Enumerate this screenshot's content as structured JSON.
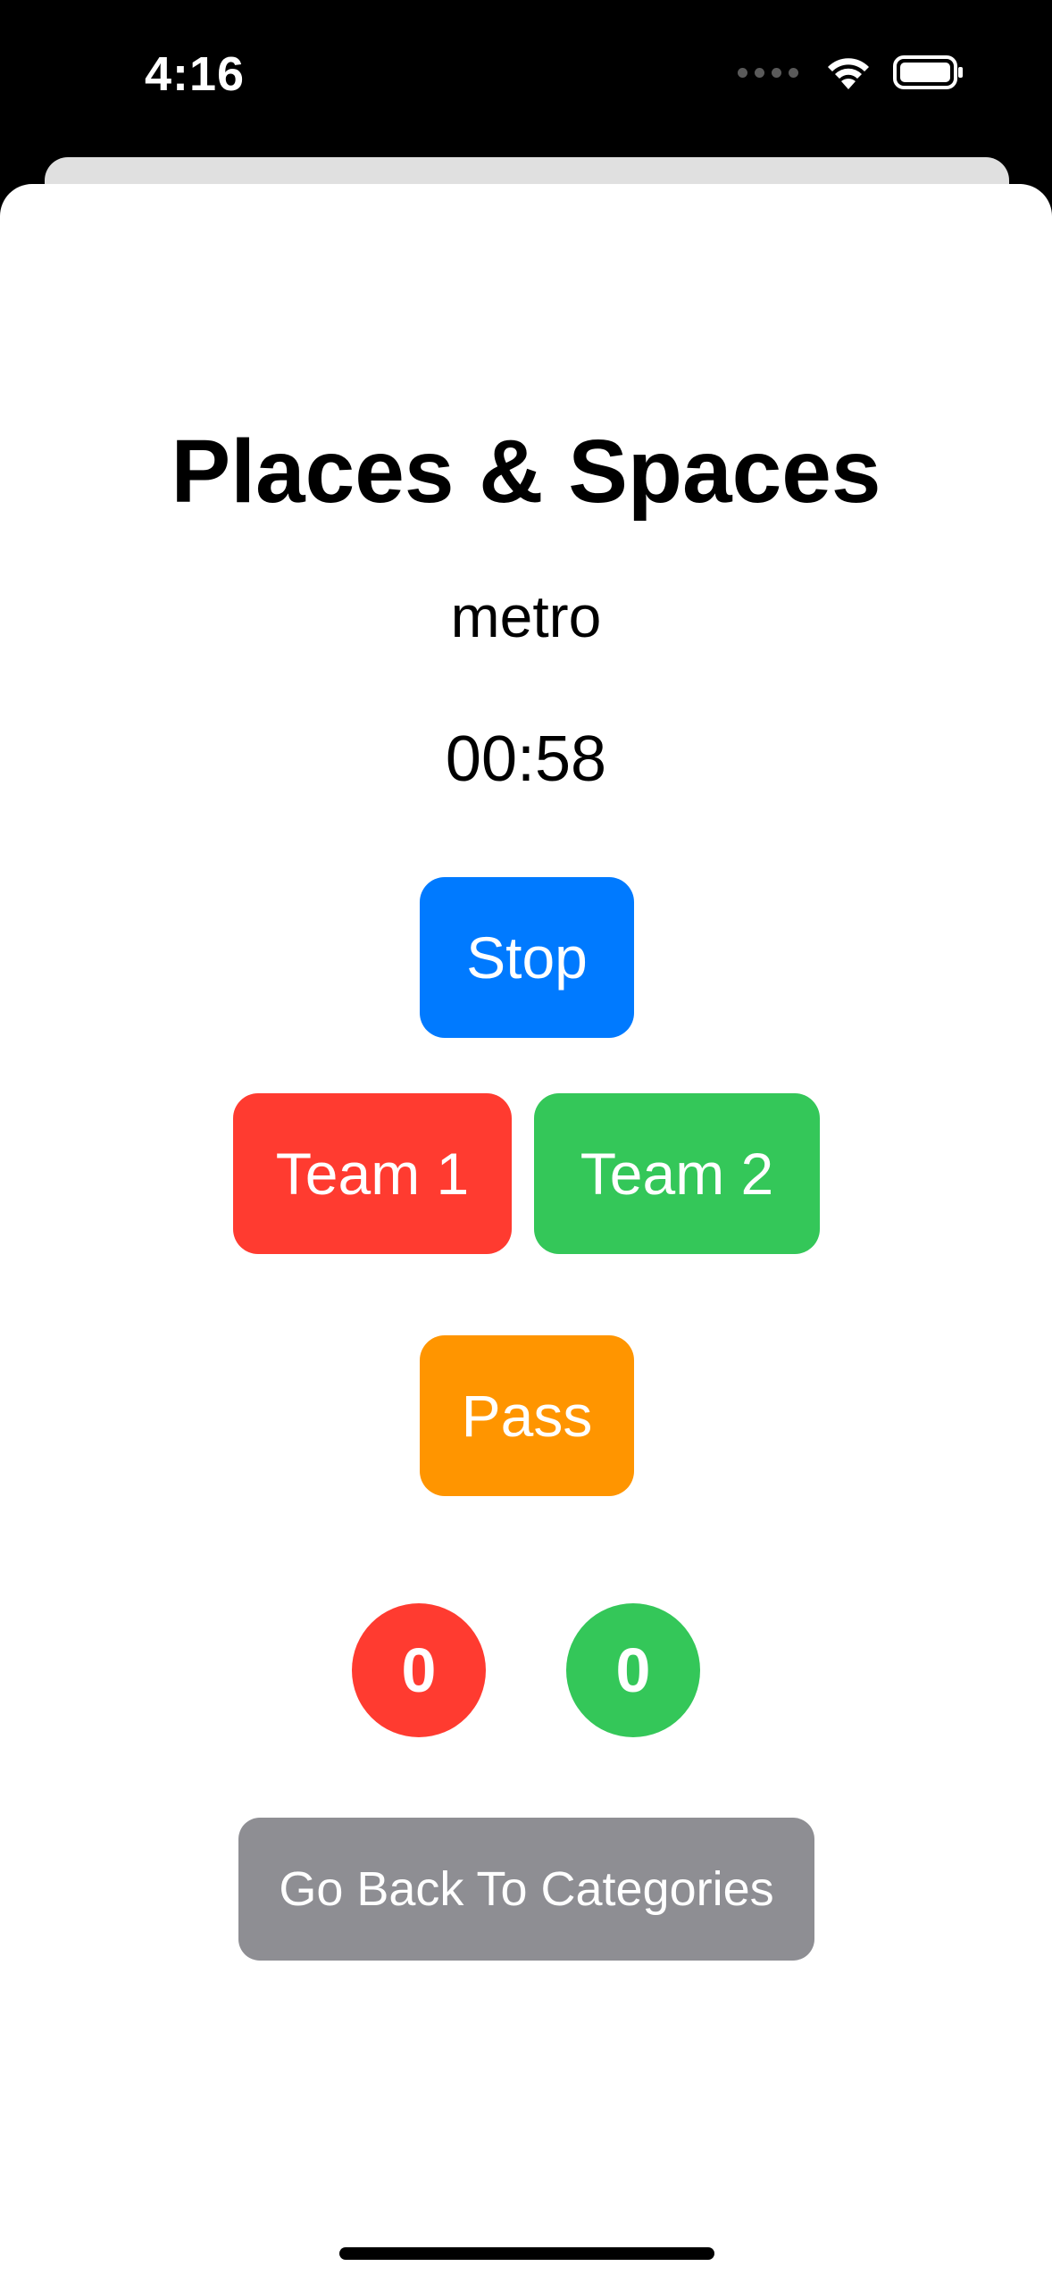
{
  "status_bar": {
    "time": "4:16",
    "icons": [
      "signal-dots-icon",
      "wifi-icon",
      "battery-icon"
    ]
  },
  "game": {
    "title": "Places & Spaces",
    "word": "metro",
    "timer": "00:58"
  },
  "buttons": {
    "stop": "Stop",
    "team1": "Team 1",
    "team2": "Team 2",
    "pass": "Pass",
    "back": "Go Back To Categories"
  },
  "scores": {
    "team1": "0",
    "team2": "0"
  },
  "colors": {
    "stop": "#007aff",
    "team1": "#ff3b30",
    "team2": "#34c759",
    "pass": "#ff9500",
    "back": "#8e8e93"
  }
}
